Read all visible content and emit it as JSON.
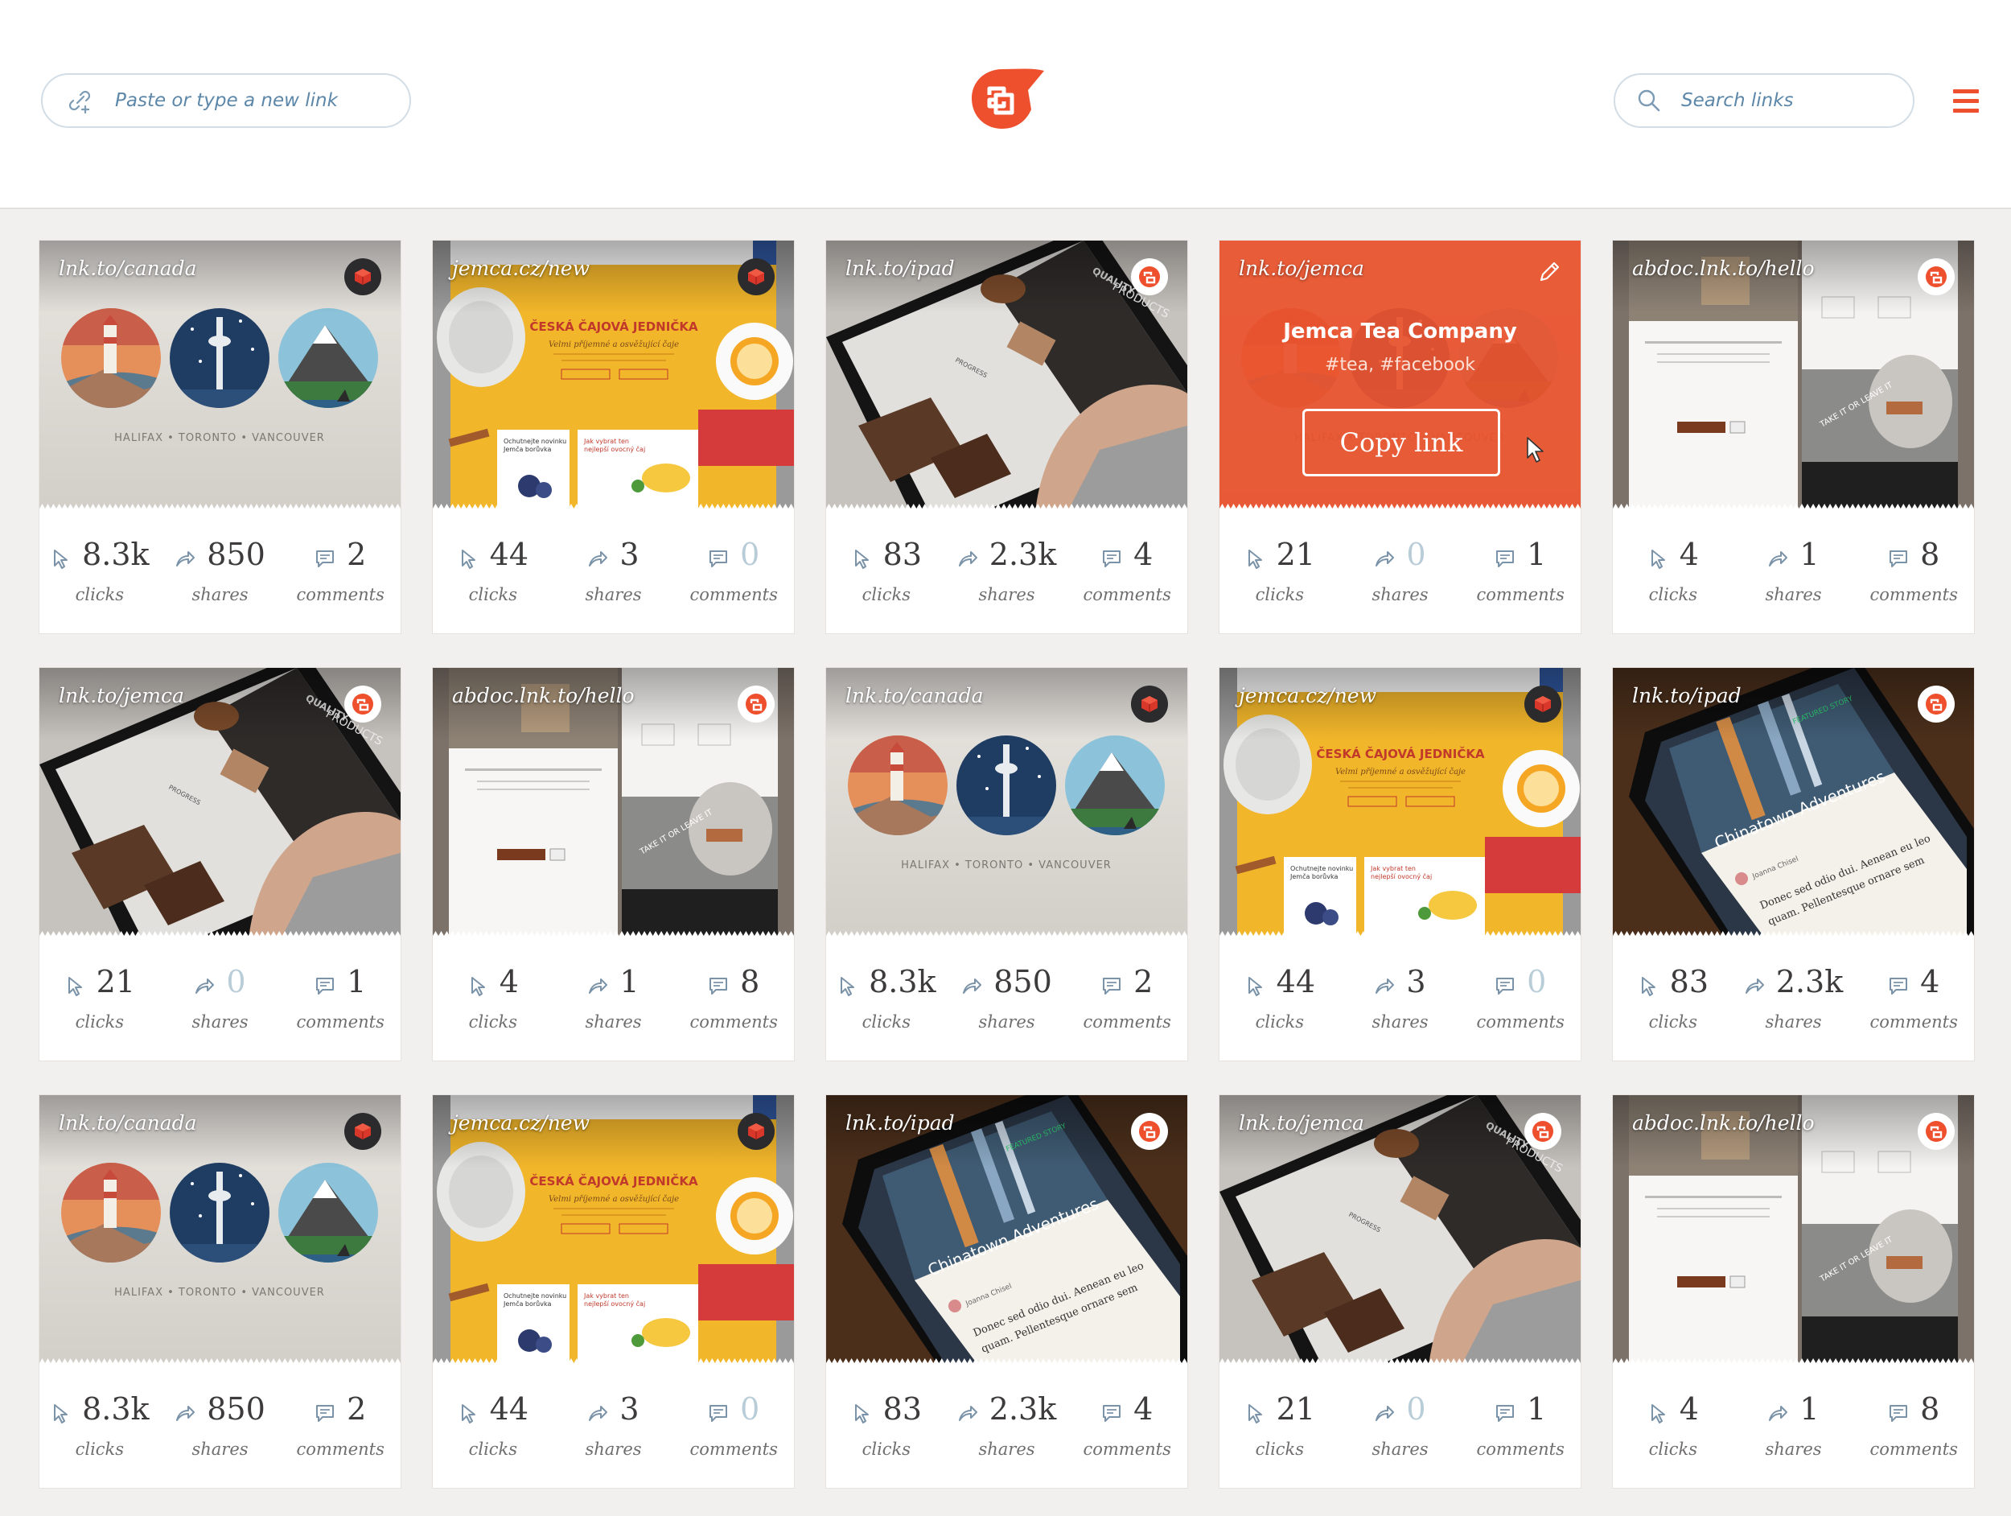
{
  "header": {
    "link_placeholder": "Paste or type a new link",
    "search_placeholder": "Search links",
    "accent": "#ee4f2d"
  },
  "labels": {
    "clicks": "clicks",
    "shares": "shares",
    "comments": "comments"
  },
  "featured": {
    "title": "Jemca Tea Company",
    "tags": "#tea, #facebook",
    "copy_label": "Copy link"
  },
  "cards": [
    {
      "url": "lnk.to/canada",
      "theme": "canada",
      "badge": "dark",
      "clicks": "8.3k",
      "shares": "850",
      "comments": "2"
    },
    {
      "url": "jemca.cz/new",
      "theme": "jemca",
      "badge": "dark",
      "clicks": "44",
      "shares": "3",
      "comments": "0"
    },
    {
      "url": "lnk.to/ipad",
      "theme": "ipad",
      "badge": "light",
      "clicks": "83",
      "shares": "2.3k",
      "comments": "4"
    },
    {
      "url": "lnk.to/jemca",
      "theme": "featured",
      "badge": "none",
      "clicks": "21",
      "shares": "0",
      "comments": "1"
    },
    {
      "url": "abdoc.lnk.to/hello",
      "theme": "abdoc",
      "badge": "light",
      "clicks": "4",
      "shares": "1",
      "comments": "8"
    },
    {
      "url": "lnk.to/jemca",
      "theme": "ipad",
      "badge": "light",
      "clicks": "21",
      "shares": "0",
      "comments": "1"
    },
    {
      "url": "abdoc.lnk.to/hello",
      "theme": "abdoc",
      "badge": "light",
      "clicks": "4",
      "shares": "1",
      "comments": "8"
    },
    {
      "url": "lnk.to/canada",
      "theme": "canada",
      "badge": "dark",
      "clicks": "8.3k",
      "shares": "850",
      "comments": "2"
    },
    {
      "url": "jemca.cz/new",
      "theme": "jemca",
      "badge": "dark",
      "clicks": "44",
      "shares": "3",
      "comments": "0"
    },
    {
      "url": "lnk.to/ipad",
      "theme": "chinatown",
      "badge": "light",
      "clicks": "83",
      "shares": "2.3k",
      "comments": "4"
    },
    {
      "url": "lnk.to/canada",
      "theme": "canada",
      "badge": "dark",
      "clicks": "8.3k",
      "shares": "850",
      "comments": "2"
    },
    {
      "url": "jemca.cz/new",
      "theme": "jemca",
      "badge": "dark",
      "clicks": "44",
      "shares": "3",
      "comments": "0"
    },
    {
      "url": "lnk.to/ipad",
      "theme": "chinatown",
      "badge": "light",
      "clicks": "83",
      "shares": "2.3k",
      "comments": "4"
    },
    {
      "url": "lnk.to/jemca",
      "theme": "ipad",
      "badge": "light",
      "clicks": "21",
      "shares": "0",
      "comments": "1"
    },
    {
      "url": "abdoc.lnk.to/hello",
      "theme": "abdoc",
      "badge": "light",
      "clicks": "4",
      "shares": "1",
      "comments": "8"
    }
  ],
  "canada_caption": "HALIFAX • TORONTO • VANCOUVER",
  "jemca_headline": "ČESKÁ ČAJOVÁ JEDNIČKA",
  "jemca_sub": "Velmi příjemné a osvěžující čaje",
  "jemca_box1": "Ochutnejte novinku Jemča borůvka",
  "jemca_box2": "Jak vybrat ten nejlepší ovocný čaj",
  "ipad_word1": "QUALITY",
  "ipad_word2": "PRODUCTS",
  "ipad_word3": "PROGRESS",
  "chinatown_title": "Chinatown Adventures",
  "chinatown_author": "Joanna Chisel",
  "chinatown_text": "Donec sed odio dui. Aenean eu leo quam. Pellentesque ornare sem lacinia quam venenatis vestibulum. Duis mollis, est",
  "chinatown_tag": "FEATURED STORY",
  "abdoc_line": "TAKE IT OR LEAVE IT"
}
